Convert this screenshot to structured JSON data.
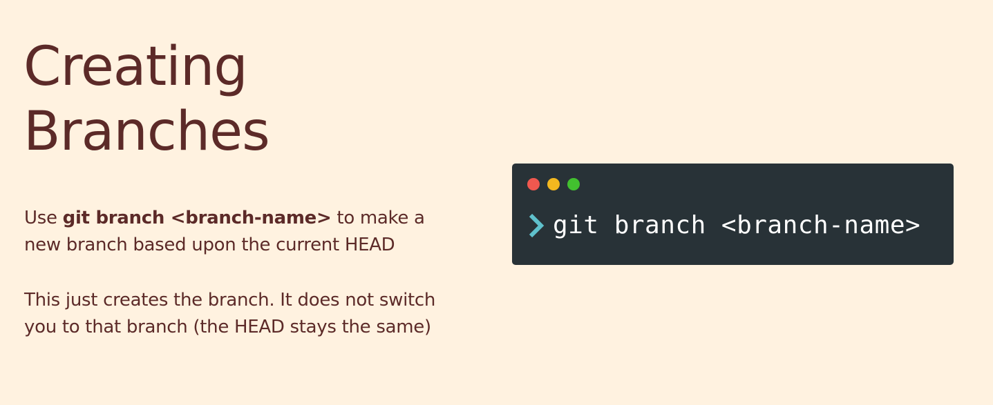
{
  "slide": {
    "title_line1": "Creating",
    "title_line2": "Branches"
  },
  "paragraph1": {
    "prefix": "Use ",
    "command": "git branch <branch-name>",
    "suffix": " to make a",
    "line2": "new branch based upon the current HEAD"
  },
  "paragraph2": {
    "line1": "This just creates the branch.  It does not switch",
    "line2": "you to that branch (the HEAD stays the same)"
  },
  "terminal": {
    "command": "git branch <branch-name>",
    "prompt_icon": "chevron-right-icon",
    "colors": {
      "background": "#283237",
      "close": "#f0584f",
      "minimize": "#f3b81f",
      "maximize": "#42c02f",
      "prompt": "#5fc1cc"
    }
  },
  "colors": {
    "page_background": "#fff2e0",
    "text": "#5c2a28"
  }
}
